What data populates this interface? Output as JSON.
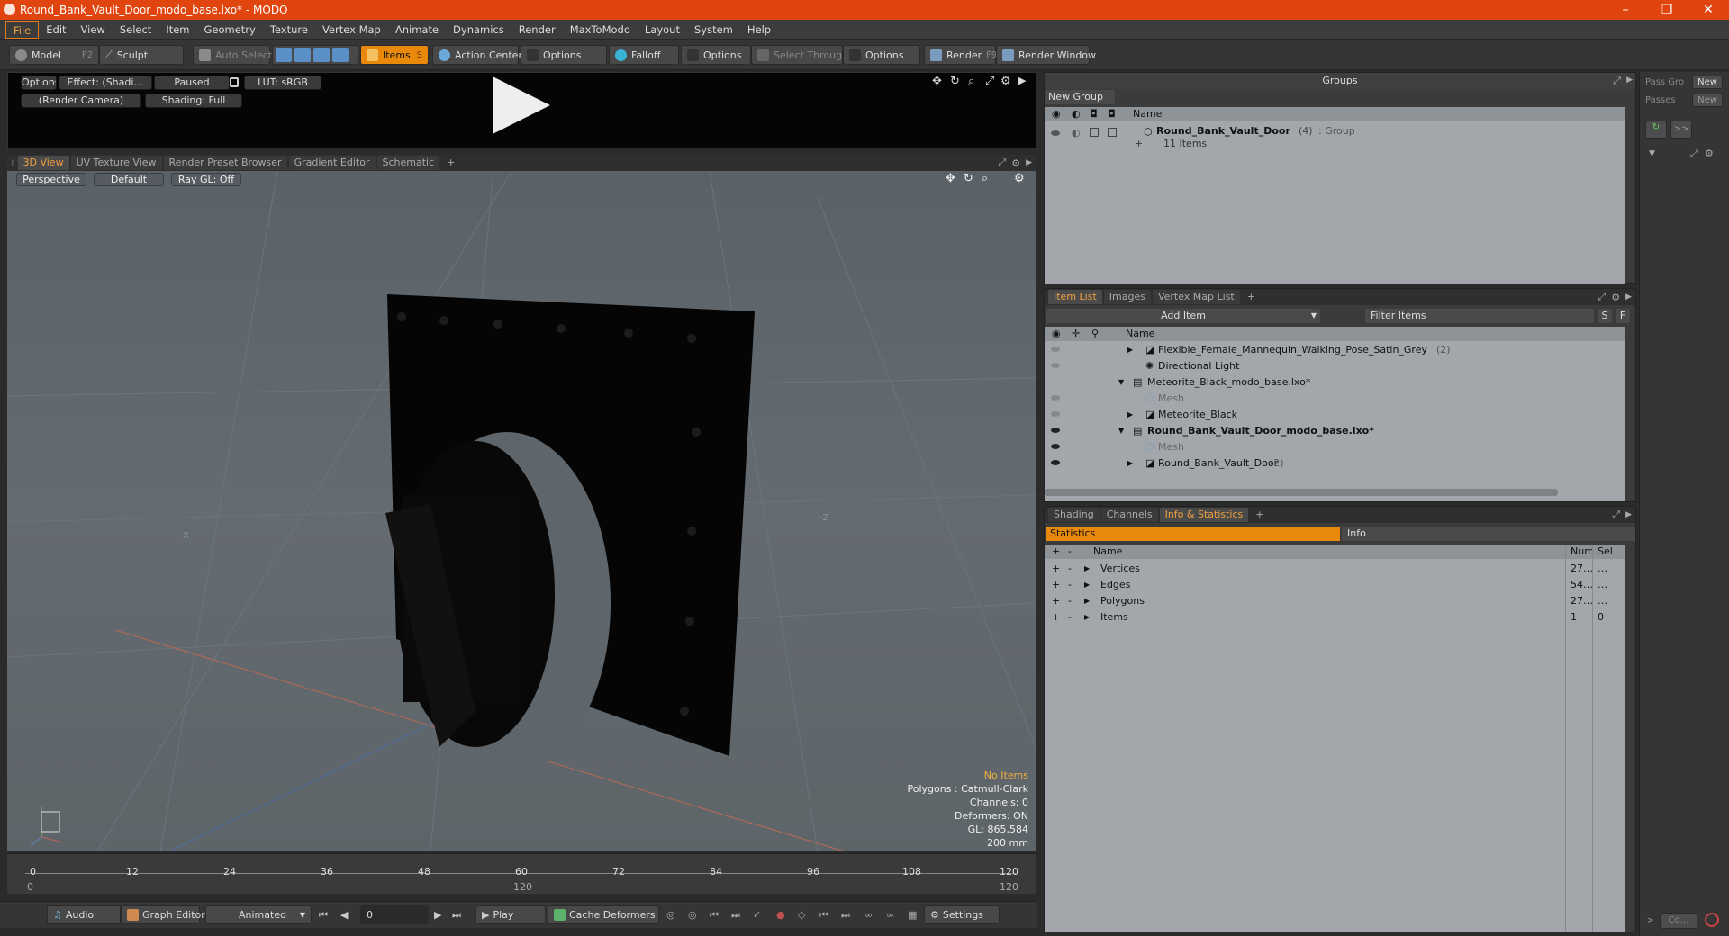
{
  "window": {
    "title": "Round_Bank_Vault_Door_modo_base.lxo* - MODO",
    "min": "–",
    "max": "❐",
    "close": "✕"
  },
  "menu": [
    "File",
    "Edit",
    "View",
    "Select",
    "Item",
    "Geometry",
    "Texture",
    "Vertex Map",
    "Animate",
    "Dynamics",
    "Render",
    "MaxToModo",
    "Layout",
    "System",
    "Help"
  ],
  "toolbar": {
    "model": "Model",
    "model_key": "F2",
    "sculpt": "Sculpt",
    "auto_select": "Auto Select",
    "items": "Items",
    "items_key": "S",
    "action_center": "Action Center",
    "options1": "Options",
    "falloff": "Falloff",
    "options2": "Options",
    "select_through": "Select Through",
    "options3": "Options",
    "render": "Render",
    "render_key": "F9",
    "render_window": "Render Window"
  },
  "preview": {
    "options": "Options",
    "effect": "Effect: (Shadi…",
    "paused": "Paused",
    "lut": "LUT: sRGB",
    "camera": "(Render Camera)",
    "shading": "Shading: Full"
  },
  "view_tabs": [
    "3D View",
    "UV Texture View",
    "Render Preset Browser",
    "Gradient Editor",
    "Schematic",
    "+"
  ],
  "viewport": {
    "perspective": "Perspective",
    "default": "Default",
    "raygl": "Ray GL: Off",
    "axis_x": "-X",
    "axis_z": "-Z",
    "info": {
      "no_items": "No Items",
      "polygons": "Polygons : Catmull-Clark",
      "channels": "Channels: 0",
      "deformers": "Deformers: ON",
      "gl": "GL: 865,584",
      "scale": "200 mm"
    }
  },
  "timeline": {
    "ticks": [
      "0",
      "12",
      "24",
      "36",
      "48",
      "60",
      "72",
      "84",
      "96",
      "108",
      "120"
    ],
    "low": [
      "0",
      "120",
      "120"
    ]
  },
  "transport": {
    "audio": "Audio",
    "graph_editor": "Graph Editor",
    "animated": "Animated",
    "frame": "0",
    "play": "Play",
    "cache": "Cache Deformers",
    "settings": "Settings"
  },
  "groups": {
    "header": "Groups",
    "new_group": "New Group",
    "col_name": "Name",
    "item_name": "Round_Bank_Vault_Door",
    "item_count": "(4)",
    "item_type": ": Group",
    "item_sub": "11 Items"
  },
  "itemlist": {
    "tabs": [
      "Item List",
      "Images",
      "Vertex Map List",
      "+"
    ],
    "add_item": "Add Item",
    "filter": "Filter Items",
    "s": "S",
    "f": "F",
    "col_name": "Name",
    "rows": [
      {
        "name": "Flexible_Female_Mannequin_Walking_Pose_Satin_Grey",
        "count": "(2)"
      },
      {
        "name": "Directional Light",
        "count": ""
      },
      {
        "name": "Meteorite_Black_modo_base.lxo*",
        "count": ""
      },
      {
        "name": "Mesh",
        "count": ""
      },
      {
        "name": "Meteorite_Black",
        "count": ""
      },
      {
        "name": "Round_Bank_Vault_Door_modo_base.lxo*",
        "count": ""
      },
      {
        "name": "Mesh",
        "count": ""
      },
      {
        "name": "Round_Bank_Vault_Door",
        "count": "(2)"
      }
    ]
  },
  "stats": {
    "tabs": [
      "Shading",
      "Channels",
      "Info & Statistics",
      "+"
    ],
    "statistics": "Statistics",
    "info": "Info",
    "col_name": "Name",
    "col_num": "Num",
    "col_sel": "Sel",
    "rows": [
      {
        "name": "Vertices",
        "num": "27…",
        "sel": "…"
      },
      {
        "name": "Edges",
        "num": "54…",
        "sel": "…"
      },
      {
        "name": "Polygons",
        "num": "27…",
        "sel": "…"
      },
      {
        "name": "Items",
        "num": "1",
        "sel": "0"
      }
    ]
  },
  "rightbar": {
    "pass_gro": "Pass Gro",
    "new1": "New",
    "passes": "Passes",
    "new2": "New",
    "more": ">>",
    "co": "Co…"
  }
}
